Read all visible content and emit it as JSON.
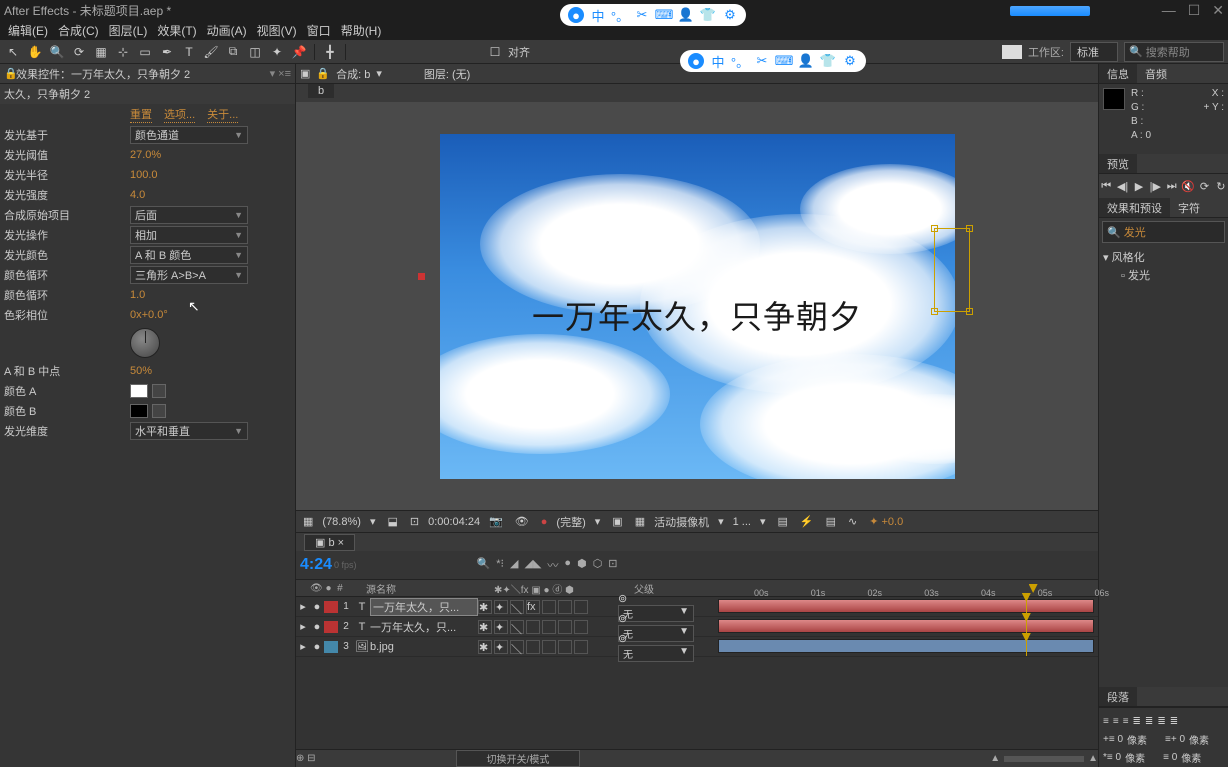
{
  "title": "After Effects - 未标题项目.aep *",
  "menus": [
    "编辑(E)",
    "合成(C)",
    "图层(L)",
    "效果(T)",
    "动画(A)",
    "视图(V)",
    "窗口",
    "帮助(H)"
  ],
  "align_label": "对齐",
  "workspace": {
    "label": "工作区:",
    "value": "标准"
  },
  "search_help_placeholder": "搜索帮助",
  "effects_panel": {
    "header": "效果控件：一万年太久，只争朝夕 2",
    "subheader": "太久，只争朝夕 2",
    "links": [
      "重置",
      "选项...",
      "关于..."
    ],
    "props": [
      {
        "label": "发光基于",
        "type": "dd",
        "value": "颜色通道"
      },
      {
        "label": "发光阈值",
        "type": "val",
        "value": "27.0%"
      },
      {
        "label": "发光半径",
        "type": "val",
        "value": "100.0"
      },
      {
        "label": "发光强度",
        "type": "val",
        "value": "4.0"
      },
      {
        "label": "合成原始项目",
        "type": "dd",
        "value": "后面"
      },
      {
        "label": "发光操作",
        "type": "dd",
        "value": "相加"
      },
      {
        "label": "发光颜色",
        "type": "dd",
        "value": "A 和 B 颜色"
      },
      {
        "label": "颜色循环",
        "type": "dd",
        "value": "三角形 A>B>A"
      },
      {
        "label": "颜色循环",
        "type": "val",
        "value": "1.0"
      },
      {
        "label": "色彩相位",
        "type": "val",
        "value": "0x+0.0°"
      },
      {
        "label": "",
        "type": "dial",
        "value": ""
      },
      {
        "label": "A 和 B 中点",
        "type": "val",
        "value": "50%"
      },
      {
        "label": "颜色 A",
        "type": "color",
        "value": "#ffffff"
      },
      {
        "label": "颜色 B",
        "type": "color",
        "value": "#000000"
      },
      {
        "label": "发光维度",
        "type": "dd",
        "value": "水平和垂直"
      }
    ]
  },
  "comp_header": {
    "comp_label": "合成: b",
    "layer_label": "图层: (无)",
    "tab": "b"
  },
  "canvas_text": "一万年太久，只争朝夕",
  "comp_footer": {
    "zoom": "(78.8%)",
    "time": "0:00:04:24",
    "res": "(完整)",
    "camera": "活动摄像机",
    "views": "1 ..."
  },
  "info_panel": {
    "tabs": [
      "信息",
      "音频"
    ],
    "r": "R :",
    "g": "G :",
    "b": "B :",
    "a": "A : 0",
    "x": "X :",
    "y": "Y :",
    "plus": "+"
  },
  "preview_tab": "预览",
  "effects_presets": {
    "tabs": [
      "效果和预设",
      "字符"
    ],
    "search": "发光",
    "cat": "风格化",
    "item": "发光"
  },
  "paragraph_tab": "段落",
  "paragraph": {
    "l1": "+≡ 0",
    "l1u": "像素",
    "r1": "≡+ 0",
    "r1u": "像素",
    "l2": "*≡ 0",
    "l2u": "像素",
    "r2": "≡ 0",
    "r2u": "像素"
  },
  "timeline": {
    "tab": "b",
    "timecode": "4:24",
    "fps": "0 fps)",
    "cols": {
      "num": "#",
      "src": "源名称",
      "parent": "父级"
    },
    "ticks": [
      "00s",
      "01s",
      "02s",
      "03s",
      "04s",
      "05s",
      "06s"
    ],
    "layers": [
      {
        "num": "1",
        "color": "#b33",
        "icon": "T",
        "name": "一万年太久，只...",
        "parent": "无",
        "clip_color": "linear-gradient(#d88,#a44)",
        "fx": true
      },
      {
        "num": "2",
        "color": "#b33",
        "icon": "T",
        "name": "一万年太久，只...",
        "parent": "无",
        "clip_color": "linear-gradient(#d88,#a44)",
        "fx": false
      },
      {
        "num": "3",
        "color": "#48a",
        "icon": "🖼",
        "name": "b.jpg",
        "parent": "无",
        "clip_color": "#6a8ab0",
        "fx": false
      }
    ],
    "footer_btn": "切换开关/模式"
  }
}
